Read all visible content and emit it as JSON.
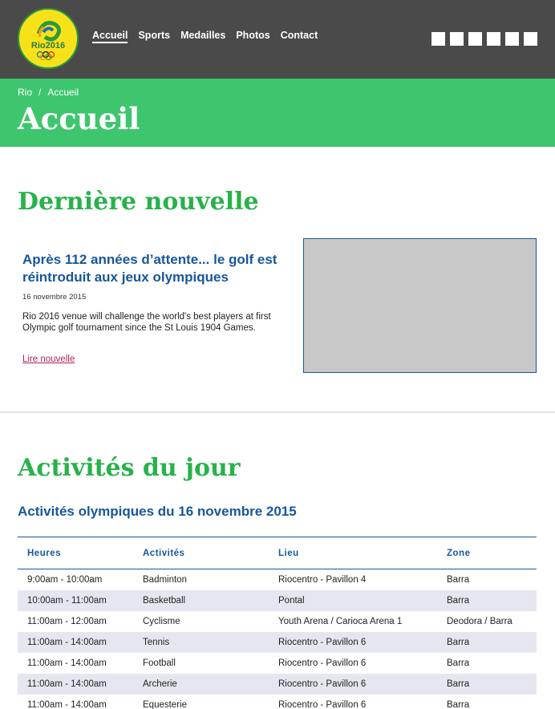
{
  "header": {
    "logo_text": "Rio2016",
    "nav": [
      "Accueil",
      "Sports",
      "Medailles",
      "Photos",
      "Contact"
    ],
    "social_icons": [
      "social-icon-1",
      "social-icon-2",
      "social-icon-3",
      "social-icon-4",
      "social-icon-5",
      "social-icon-6"
    ]
  },
  "breadcrumb": {
    "root": "Rio",
    "separator": "/",
    "current": "Accueil"
  },
  "page_title": "Accueil",
  "news_section": {
    "title": "Dernière nouvelle",
    "headline": "Après 112 années d’attente... le golf est réintroduit aux jeux olympiques",
    "date": "16 novembre 2015",
    "body": "Rio 2016 venue will challenge the world's best players at first Olympic golf tournament since the St Louis 1904 Games.",
    "link": "Lire nouvelle"
  },
  "activities_section": {
    "title": "Activités du jour",
    "subtitle": "Activités olympiques du 16 novembre 2015",
    "columns": [
      "Heures",
      "Activités",
      "Lieu",
      "Zone"
    ],
    "rows": [
      [
        "9:00am - 10:00am",
        "Badminton",
        "Riocentro - Pavillon 4",
        "Barra"
      ],
      [
        "10:00am - 11:00am",
        "Basketball",
        "Pontal",
        "Barra"
      ],
      [
        "11:00am - 12:00am",
        "Cyclisme",
        "Youth Arena / Carioca Arena 1",
        "Deodora / Barra"
      ],
      [
        "11:00am - 14:00am",
        "Tennis",
        "Riocentro - Pavillon 6",
        "Barra"
      ],
      [
        "11:00am - 14:00am",
        "Football",
        "Riocentro - Pavillon 6",
        "Barra"
      ],
      [
        "11:00am - 14:00am",
        "Archerie",
        "Riocentro - Pavillon 6",
        "Barra"
      ],
      [
        "11:00am - 14:00am",
        "Equesterie",
        "Riocentro - Pavillon 6",
        "Barra"
      ]
    ]
  },
  "colors": {
    "header_bg": "#4a4a4a",
    "band_green": "#3ec66e",
    "heading_green": "#27b24a",
    "link_blue": "#17579a",
    "link_pink": "#b21e5f",
    "row_alt": "#e6e6f0"
  }
}
